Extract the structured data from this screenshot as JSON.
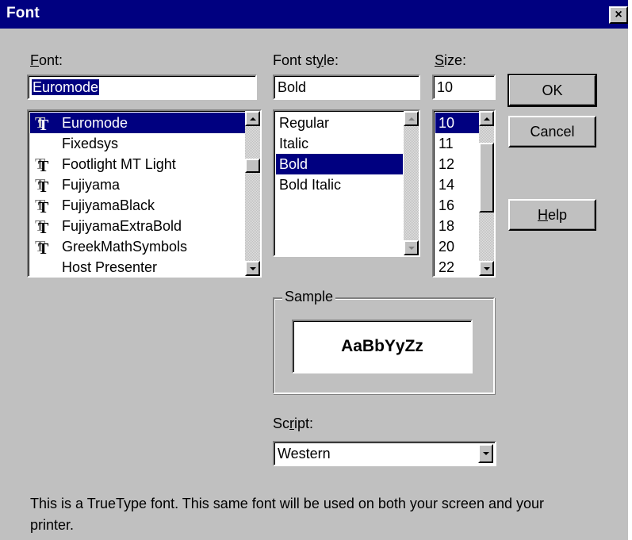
{
  "window": {
    "title": "Font",
    "close_glyph": "×"
  },
  "font": {
    "label_key": "F",
    "label_rest": "ont:",
    "value": "Euromode",
    "items": [
      {
        "name": "Euromode",
        "truetype": true,
        "selected": true
      },
      {
        "name": "Fixedsys",
        "truetype": false,
        "selected": false
      },
      {
        "name": "Footlight MT Light",
        "truetype": true,
        "selected": false
      },
      {
        "name": "Fujiyama",
        "truetype": true,
        "selected": false
      },
      {
        "name": "FujiyamaBlack",
        "truetype": true,
        "selected": false
      },
      {
        "name": "FujiyamaExtraBold",
        "truetype": true,
        "selected": false
      },
      {
        "name": "GreekMathSymbols",
        "truetype": true,
        "selected": false
      },
      {
        "name": "Host Presenter",
        "truetype": false,
        "selected": false
      }
    ]
  },
  "font_style": {
    "label_pre": "Font st",
    "label_key": "y",
    "label_post": "le:",
    "value": "Bold",
    "items": [
      {
        "name": "Regular",
        "selected": false
      },
      {
        "name": "Italic",
        "selected": false
      },
      {
        "name": "Bold",
        "selected": true
      },
      {
        "name": "Bold Italic",
        "selected": false
      }
    ]
  },
  "size": {
    "label_key": "S",
    "label_rest": "ize:",
    "value": "10",
    "items": [
      {
        "name": "10",
        "selected": true
      },
      {
        "name": "11",
        "selected": false
      },
      {
        "name": "12",
        "selected": false
      },
      {
        "name": "14",
        "selected": false
      },
      {
        "name": "16",
        "selected": false
      },
      {
        "name": "18",
        "selected": false
      },
      {
        "name": "20",
        "selected": false
      },
      {
        "name": "22",
        "selected": false
      }
    ]
  },
  "buttons": {
    "ok": "OK",
    "cancel": "Cancel",
    "help_key": "H",
    "help_rest": "elp"
  },
  "sample": {
    "label": "Sample",
    "text": "AaBbYyZz"
  },
  "script": {
    "label_pre": "Sc",
    "label_key": "r",
    "label_post": "ipt:",
    "value": "Western"
  },
  "description": "This is a TrueType font. This same font will be used on both your screen and your printer.",
  "icons": {
    "truetype": "TT"
  },
  "colors": {
    "title_bar": "#000080",
    "face": "#c0c0c0",
    "selection": "#000080"
  }
}
